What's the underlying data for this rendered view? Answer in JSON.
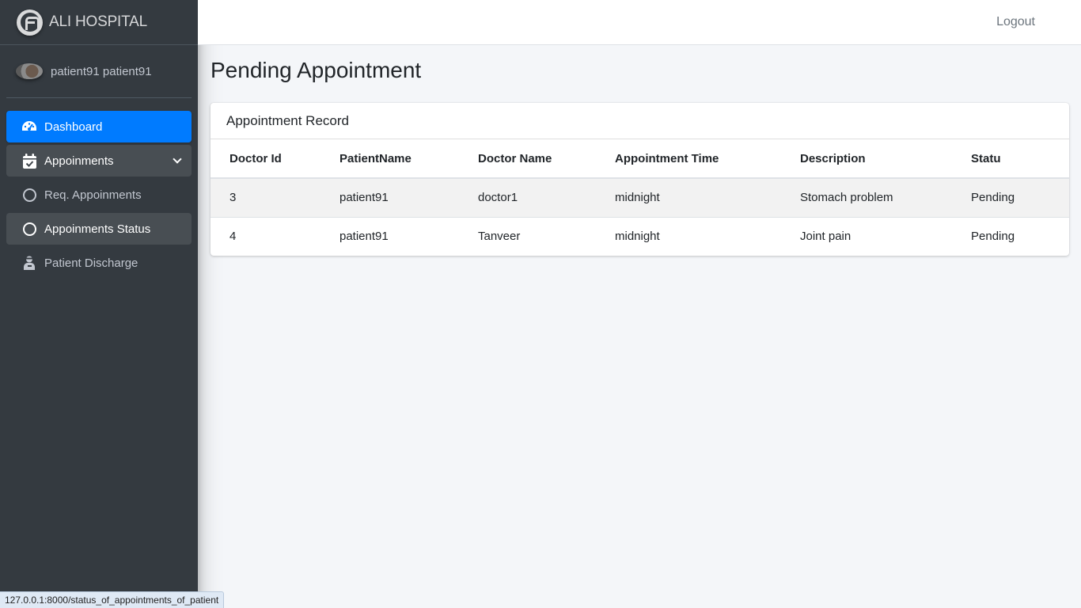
{
  "brand": {
    "name": "ALI HOSPITAL"
  },
  "user": {
    "name": "patient91 patient91"
  },
  "sidebar": {
    "items": [
      {
        "label": "Dashboard"
      },
      {
        "label": "Appoinments"
      },
      {
        "label": "Req. Appoinments"
      },
      {
        "label": "Appoinments Status"
      },
      {
        "label": "Patient Discharge"
      }
    ]
  },
  "header": {
    "logout": "Logout"
  },
  "main": {
    "title": "Pending Appointment",
    "card_title": "Appointment Record",
    "columns": [
      "Doctor Id",
      "PatientName",
      "Doctor Name",
      "Appointment Time",
      "Description",
      "Statu"
    ],
    "rows": [
      [
        "3",
        "patient91",
        "doctor1",
        "midnight",
        "Stomach problem",
        "Pending"
      ],
      [
        "4",
        "patient91",
        "Tanveer",
        "midnight",
        "Joint pain",
        "Pending"
      ]
    ]
  },
  "statusbar": {
    "url": "127.0.0.1:8000/status_of_appointments_of_patient"
  },
  "colors": {
    "sidebar": "#343a40",
    "accent": "#007bff",
    "background": "#f4f6f9"
  }
}
